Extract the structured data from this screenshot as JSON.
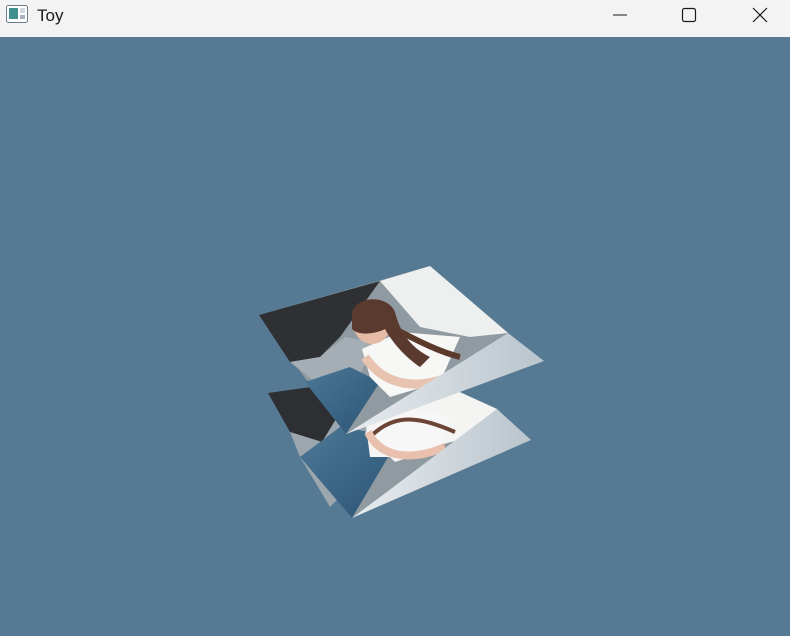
{
  "window": {
    "title": "Toy",
    "background_color": "#577a94",
    "titlebar_color": "#f3f3f3",
    "controls": {
      "minimize_icon": "minimize-icon",
      "maximize_icon": "maximize-icon",
      "close_icon": "close-icon"
    }
  },
  "scene": {
    "description_icon": "textured-folded-quads",
    "object_count": 2
  }
}
